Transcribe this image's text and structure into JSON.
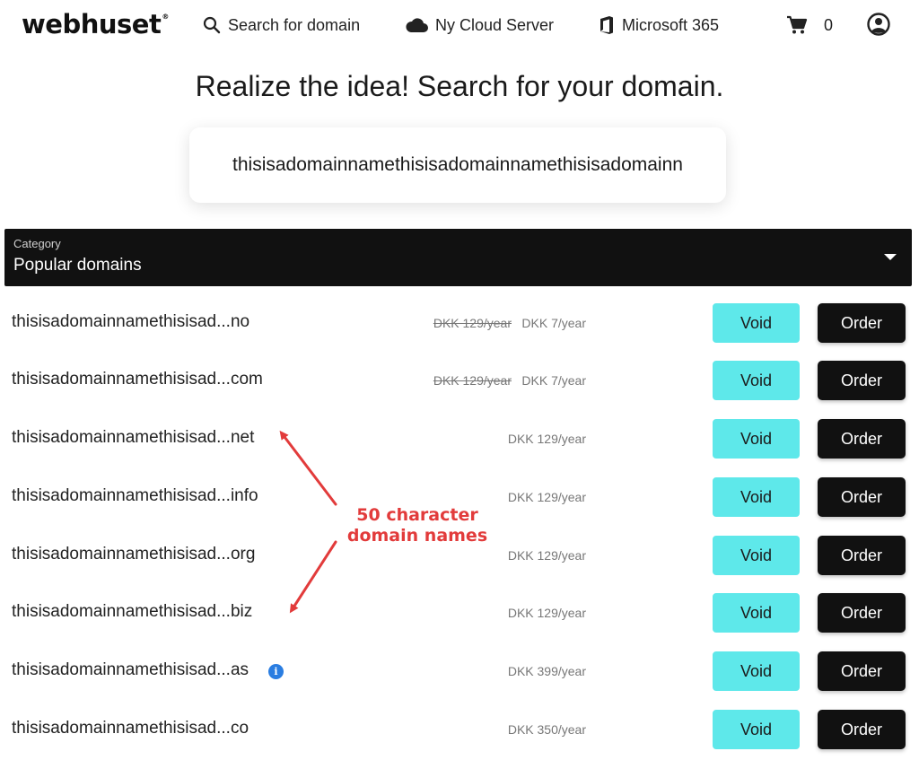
{
  "header": {
    "logo": "webhuset",
    "logo_mark": "®",
    "nav": {
      "search": "Search for domain",
      "cloud": "Ny Cloud Server",
      "microsoft": "Microsoft 365",
      "cart_count": "0"
    }
  },
  "hero": {
    "title": "Realize the idea! Search for your domain.",
    "search_value": "thisisadomainnamethisisadomainnamethisisadomainn"
  },
  "category": {
    "label": "Category",
    "value": "Popular domains"
  },
  "rows": [
    {
      "name": "thisisadomainnamethisisad...no",
      "old_price": "DKK 129/year",
      "price": "DKK 7/year"
    },
    {
      "name": "thisisadomainnamethisisad...com",
      "old_price": "DKK 129/year",
      "price": "DKK 7/year"
    },
    {
      "name": "thisisadomainnamethisisad...net",
      "old_price": "",
      "price": "DKK 129/year"
    },
    {
      "name": "thisisadomainnamethisisad...info",
      "old_price": "",
      "price": "DKK 129/year"
    },
    {
      "name": "thisisadomainnamethisisad...org",
      "old_price": "",
      "price": "DKK 129/year"
    },
    {
      "name": "thisisadomainnamethisisad...biz",
      "old_price": "",
      "price": "DKK 129/year"
    },
    {
      "name": "thisisadomainnamethisisad...as",
      "old_price": "",
      "price": "DKK 399/year",
      "info": "i"
    },
    {
      "name": "thisisadomainnamethisisad...co",
      "old_price": "",
      "price": "DKK 350/year"
    }
  ],
  "buttons": {
    "void": "Void",
    "order": "Order"
  },
  "annotation": {
    "line1": "50 character",
    "line2": "domain names",
    "color": "#e23b3b"
  },
  "colors": {
    "void_button": "#5ee8ea",
    "order_button": "#111111",
    "category_bar": "#111111",
    "info_icon": "#2a7de1"
  },
  "icons": {
    "search": "search-icon",
    "cloud": "cloud-icon",
    "microsoft": "office-icon",
    "cart": "cart-icon",
    "account": "account-icon",
    "info": "info-icon",
    "dropdown": "caret-down-icon"
  }
}
